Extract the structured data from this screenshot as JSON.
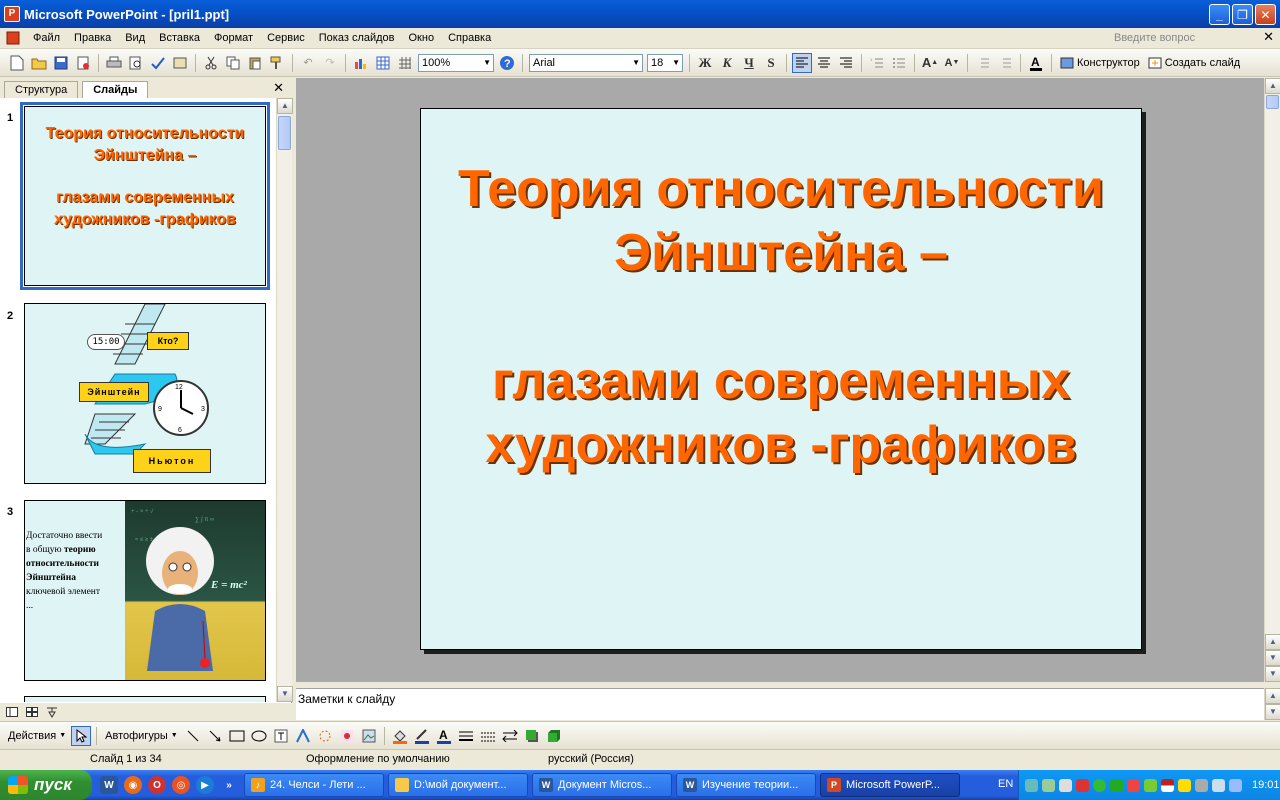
{
  "window": {
    "title": "Microsoft PowerPoint - [pril1.ppt]",
    "app_icon_letter": "P",
    "minimize": "_",
    "restore": "❐",
    "close": "✕"
  },
  "menu": {
    "items": [
      "Файл",
      "Правка",
      "Вид",
      "Вставка",
      "Формат",
      "Сервис",
      "Показ слайдов",
      "Окно",
      "Справка"
    ],
    "ask_placeholder": "Введите вопрос",
    "close_glyph": "✕"
  },
  "toolbar": {
    "zoom": "100%",
    "font_name": "Arial",
    "font_size": "18",
    "bold": "Ж",
    "italic": "К",
    "underline": "Ч",
    "shadow": "S",
    "designer_label": "Конструктор",
    "new_slide_label": "Создать слайд"
  },
  "panes": {
    "tab_outline": "Структура",
    "tab_slides": "Слайды",
    "close_glyph": "✕"
  },
  "thumbnails": {
    "slide1": {
      "num": "1",
      "line1": "Теория относительности",
      "line2": "Эйнштейна –",
      "line3": "глазами современных",
      "line4": "художников -графиков"
    },
    "slide2": {
      "num": "2",
      "clock_label": "15:00",
      "who_label": "Кто?",
      "einstein_label": "Эйнштейн",
      "newton_label": "Ньютон"
    },
    "slide3": {
      "num": "3",
      "text_a": "Достаточно ввести",
      "text_b": "в общую",
      "text_bold1": "теорию",
      "text_bold2": "относительности",
      "text_bold3": "Эйнштейна",
      "text_c": "ключевой элемент",
      "text_d": "...",
      "formula": "E = mc²"
    }
  },
  "slide": {
    "line1": "Теория относительности",
    "line2": "Эйнштейна –",
    "line3": "глазами современных",
    "line4": "художников -графиков",
    "title_color": "#ff6600",
    "background_color": "#dff5f5"
  },
  "notes": {
    "placeholder": "Заметки к слайду"
  },
  "drawing": {
    "actions_label": "Действия",
    "autoshapes_label": "Автофигуры"
  },
  "status": {
    "slide_count": "Слайд 1 из 34",
    "design": "Оформление по умолчанию",
    "language": "русский (Россия)"
  },
  "taskbar": {
    "start_label": "пуск",
    "tasks": [
      {
        "label": "24. Челси - Лети ...",
        "icon_color": "#f2a11c"
      },
      {
        "label": "D:\\мой документ...",
        "icon_color": "#f6c94a"
      },
      {
        "label": "Документ Micros...",
        "icon_color": "#2b579a"
      },
      {
        "label": "Изучение теории...",
        "icon_color": "#2b579a"
      },
      {
        "label": "Microsoft PowerP...",
        "icon_color": "#d24726"
      }
    ],
    "lang": "EN",
    "clock": "19:01"
  }
}
